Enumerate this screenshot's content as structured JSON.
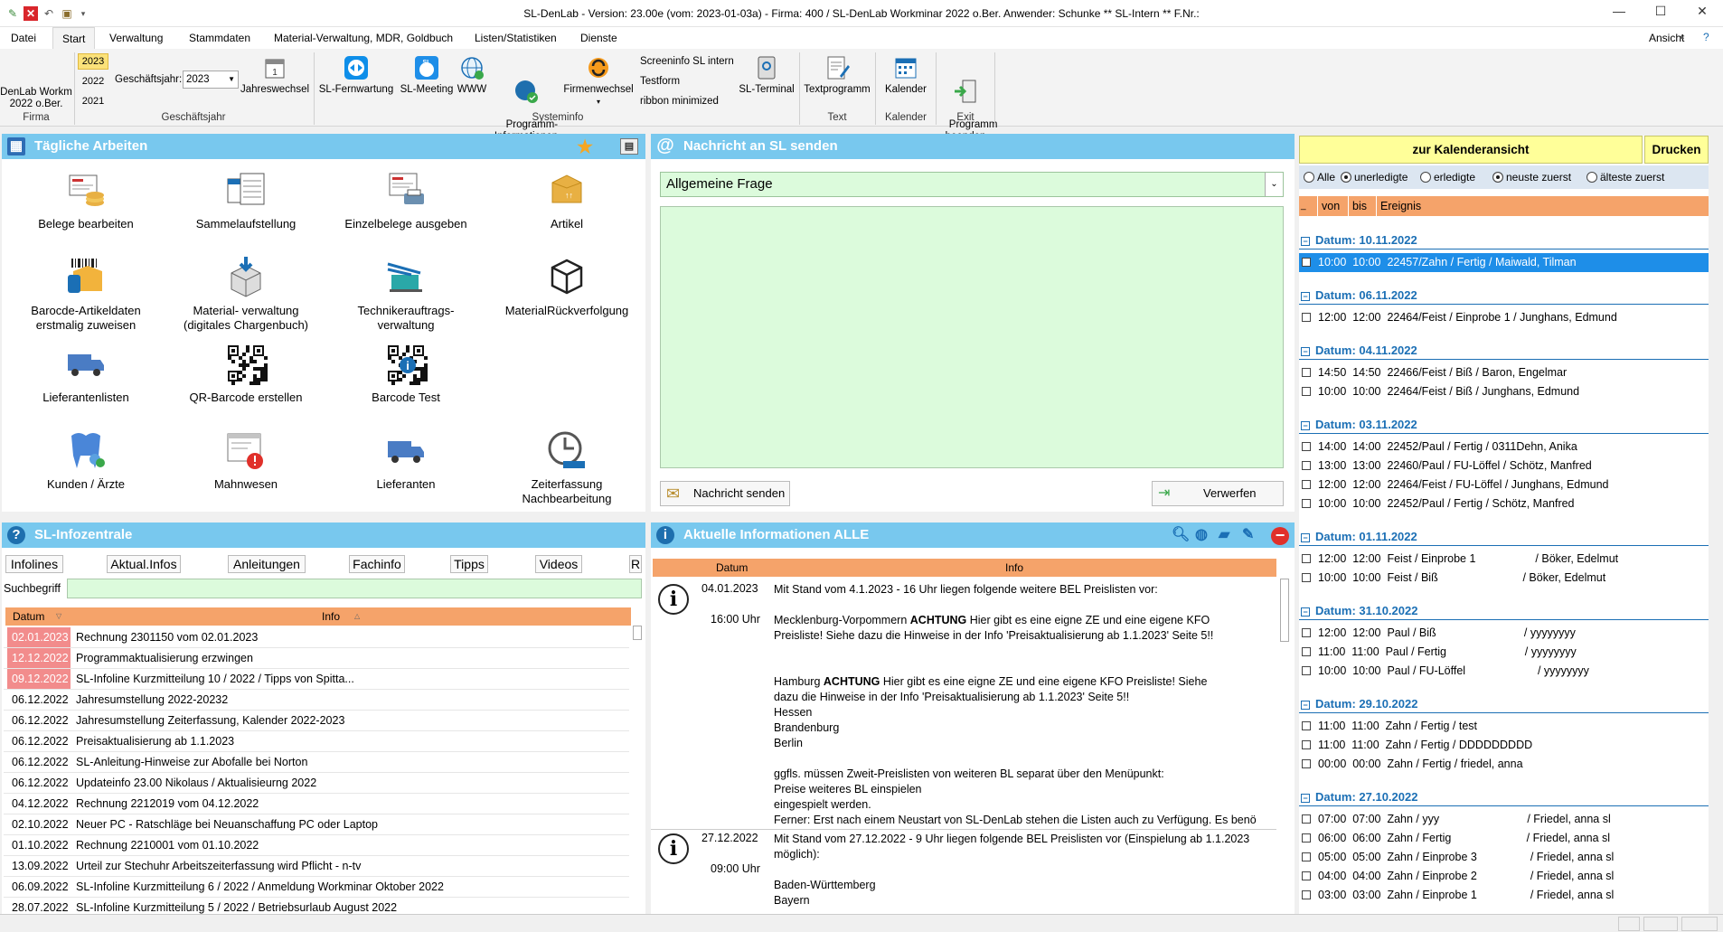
{
  "window": {
    "title": "SL-DenLab - Version: 23.00e   (vom: 2023-01-03a) - Firma: 400 / SL-DenLab Workminar 2022 o.Ber. Anwender: Schunke ** SL-Intern **  F.Nr.:"
  },
  "menu": {
    "tabs": [
      "Datei",
      "Start",
      "Verwaltung",
      "Stammdaten",
      "Material-Verwaltung, MDR, Goldbuch",
      "Listen/Statistiken",
      "Dienste"
    ],
    "right": "Ansicht"
  },
  "ribbon": {
    "firma_label": "DenLab Workm\n2022 o.Ber.",
    "firma_group": "Firma",
    "years": [
      "2023",
      "2022",
      "2021"
    ],
    "gj_label": "Geschäftsjahr:",
    "gj_value": "2023",
    "jahreswechsel": "Jahreswechsel",
    "gj_group": "Geschäftsjahr",
    "fernwartung": "SL-Fernwartung",
    "meeting": "SL-Meeting",
    "www": "WWW",
    "programminfo": "Programm-\nInformationen",
    "firmenwechsel": "Firmenwechsel",
    "screeninfo": "Screeninfo SL intern",
    "testform": "Testform",
    "ribbon_min": "ribbon minimized",
    "terminal": "SL-Terminal",
    "systeminfo_group": "Systeminfo",
    "textprogramm": "Textprogramm",
    "text_group": "Text",
    "kalender": "Kalender",
    "kalender_group": "Kalender",
    "beenden": "Programm\nbeenden",
    "exit_group": "Exit"
  },
  "taegliche": {
    "title": "Tägliche Arbeiten",
    "tiles": [
      "Belege bearbeiten",
      "Sammelaufstellung",
      "Einzelbelege ausgeben",
      "Artikel",
      "Barocde-Artikeldaten\nerstmalig zuweisen",
      "Material- verwaltung\n(digitales Chargenbuch)",
      "Technikerauftrags-\nverwaltung",
      "MaterialRückverfolgung",
      "Lieferantenlisten",
      "QR-Barcode erstellen",
      "Barcode Test",
      "",
      "Kunden  /  Ärzte",
      "Mahnwesen",
      "Lieferanten",
      "Zeiterfassung\nNachbearbeitung"
    ]
  },
  "nachricht": {
    "title": "Nachricht an SL senden",
    "dropdown": "Allgemeine Frage",
    "send": "Nachricht senden",
    "discard": "Verwerfen"
  },
  "kalender": {
    "btn": "zur Kalenderansicht",
    "print": "Drucken",
    "filters": [
      "Alle",
      "unerledigte",
      "erledigte",
      "neuste zuerst",
      "älteste zuerst"
    ],
    "cols": [
      "von",
      "bis",
      "Ereignis"
    ],
    "groups": [
      {
        "date": "Datum: 10.11.2022",
        "events": [
          "10:00  10:00  22457/Zahn / Fertig / Maiwald, Tilman"
        ]
      },
      {
        "date": "Datum: 06.11.2022",
        "events": [
          "12:00  12:00  22464/Feist / Einprobe 1 / Junghans, Edmund"
        ]
      },
      {
        "date": "Datum: 04.11.2022",
        "events": [
          "14:50  14:50  22466/Feist / Biß / Baron, Engelmar",
          "10:00  10:00  22464/Feist / Biß / Junghans, Edmund"
        ]
      },
      {
        "date": "Datum: 03.11.2022",
        "events": [
          "14:00  14:00  22452/Paul / Fertig / 0311Dehn, Anika",
          "13:00  13:00  22460/Paul / FU-Löffel / Schötz, Manfred",
          "12:00  12:00  22464/Feist / FU-Löffel / Junghans, Edmund",
          "10:00  10:00  22452/Paul / Fertig / Schötz, Manfred"
        ]
      },
      {
        "date": "Datum: 01.11.2022",
        "events": [
          "12:00  12:00  Feist / Einprobe 1                   / Böker, Edelmut",
          "10:00  10:00  Feist / Biß                           / Böker, Edelmut"
        ]
      },
      {
        "date": "Datum: 31.10.2022",
        "events": [
          "12:00  12:00  Paul / Biß                            / yyyyyyyy",
          "11:00  11:00  Paul / Fertig                         / yyyyyyyy",
          "10:00  10:00  Paul / FU-Löffel                       / yyyyyyyy"
        ]
      },
      {
        "date": "Datum: 29.10.2022",
        "events": [
          "11:00  11:00  Zahn / Fertig / test",
          "11:00  11:00  Zahn / Fertig / DDDDDDDDD",
          "00:00  00:00  Zahn / Fertig / friedel, anna"
        ]
      },
      {
        "date": "Datum: 27.10.2022",
        "events": [
          "07:00  07:00  Zahn / yyy                            / Friedel, anna sl",
          "06:00  06:00  Zahn / Fertig                        / Friedel, anna sl",
          "05:00  05:00  Zahn / Einprobe 3                 / Friedel, anna sl",
          "04:00  04:00  Zahn / Einprobe 2                 / Friedel, anna sl",
          "03:00  03:00  Zahn / Einprobe 1                 / Friedel, anna sl"
        ]
      }
    ]
  },
  "infozentrale": {
    "title": "SL-Infozentrale",
    "tabs": [
      "Infolines",
      "Aktual.Infos",
      "Anleitungen",
      "Fachinfo",
      "Tipps",
      "Videos",
      "R"
    ],
    "search_label": "Suchbegriff",
    "col_datum": "Datum",
    "col_info": "Info",
    "rows": [
      {
        "d": "02.01.2023",
        "t": "Rechnung 2301150 vom 02.01.2023",
        "red": true
      },
      {
        "d": "12.12.2022",
        "t": "Programmaktualisierung erzwingen",
        "red": true
      },
      {
        "d": "09.12.2022",
        "t": "SL-Infoline Kurzmitteilung 10   /   2022   /   Tipps von Spitta...",
        "red": true
      },
      {
        "d": "06.12.2022",
        "t": "Jahresumstellung 2022-20232",
        "red": false
      },
      {
        "d": "06.12.2022",
        "t": "Jahresumstellung Zeiterfassung,  Kalender  2022-2023",
        "red": false
      },
      {
        "d": "06.12.2022",
        "t": "Preisaktualisierung ab  1.1.2023",
        "red": false
      },
      {
        "d": "06.12.2022",
        "t": "SL-Anleitung-Hinweise zur Abofalle bei Norton",
        "red": false
      },
      {
        "d": "06.12.2022",
        "t": "Updateinfo 23.00 Nikolaus  /  Aktualisieurng 2022",
        "red": false
      },
      {
        "d": "04.12.2022",
        "t": "Rechnung 2212019 vom 04.12.2022",
        "red": false
      },
      {
        "d": "02.10.2022",
        "t": "Neuer PC - Ratschläge bei Neuanschaffung PC oder Laptop",
        "red": false
      },
      {
        "d": "01.10.2022",
        "t": "Rechnung 2210001 vom 01.10.2022",
        "red": false
      },
      {
        "d": "13.09.2022",
        "t": "Urteil zur Stechuhr Arbeitszeiterfassung wird Pflicht - n-tv",
        "red": false
      },
      {
        "d": "06.09.2022",
        "t": "SL-Infoline Kurzmitteilung 6   /   2022   /  Anmeldung Workminar Oktober 2022",
        "red": false
      },
      {
        "d": "28.07.2022",
        "t": "SL-Infoline Kurzmitteilung 5   /   2022   /   Betriebsurlaub August 2022",
        "red": false
      }
    ]
  },
  "aktuell": {
    "title": "Aktuelle Informationen ALLE",
    "col_datum": "Datum",
    "col_info": "Info",
    "entries": [
      {
        "date": "04.01.2023",
        "time": "16:00 Uhr",
        "text": "Mit Stand vom 4.1.2023 - 16 Uhr liegen folgende weitere BEL Preislisten vor:\n\nMecklenburg-Vorpommern ACHTUNG Hier gibt es eine eigne ZE und eine eigene KFO\nPreisliste! Siehe dazu die Hinweise in der Info 'Preisaktualisierung ab 1.1.2023' Seite 5!!\n\n\nHamburg ACHTUNG Hier gibt es eine eigne ZE und eine eigene KFO Preisliste! Siehe\ndazu die Hinweise in der Info 'Preisaktualisierung ab 1.1.2023' Seite 5!!\nHessen\nBrandenburg\nBerlin\n\nggfls. müssen Zweit-Preislisten von weiteren BL separat über den Menüpunkt:\nPreise weiteres BL einspielen\neingespielt werden.\nFerner: Erst nach einem Neustart von SL-DenLab stehen die Listen auch zu Verfügung. Es benö"
      },
      {
        "date": "27.12.2022",
        "time": "09:00 Uhr",
        "text": "Mit Stand vom 27.12.2022 - 9 Uhr liegen folgende BEL Preislisten vor (Einspielung ab 1.1.2023\nmöglich):\n\nBaden-Württemberg\nBayern"
      }
    ]
  }
}
